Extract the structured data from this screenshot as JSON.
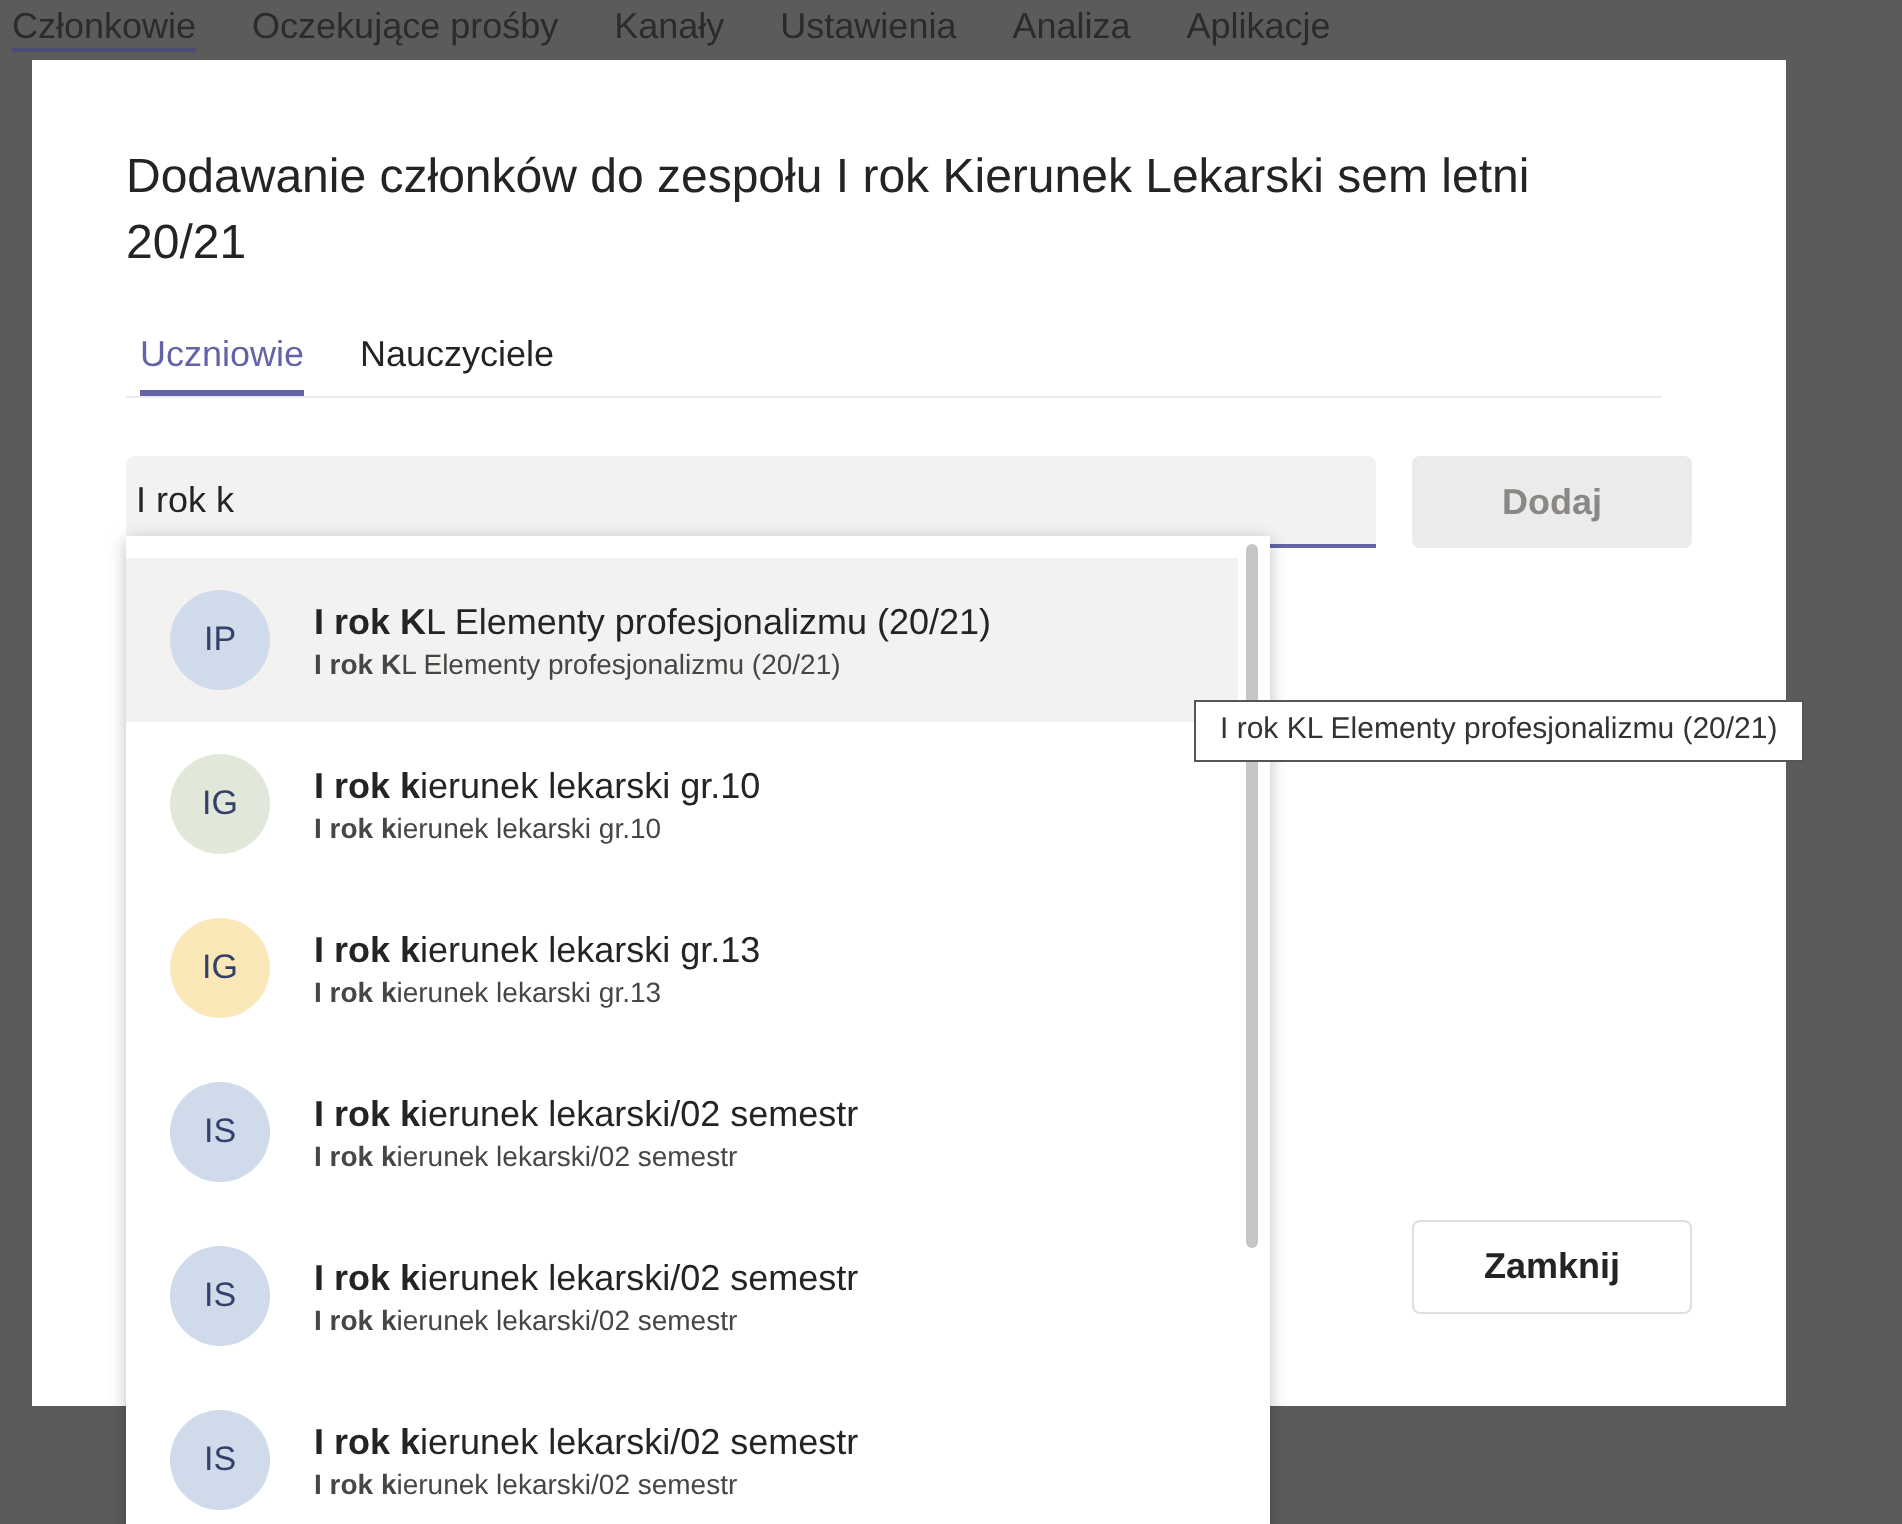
{
  "background_tabs": [
    {
      "label": "Członkowie",
      "selected": true
    },
    {
      "label": "Oczekujące prośby",
      "selected": false
    },
    {
      "label": "Kanały",
      "selected": false
    },
    {
      "label": "Ustawienia",
      "selected": false
    },
    {
      "label": "Analiza",
      "selected": false
    },
    {
      "label": "Aplikacje",
      "selected": false
    }
  ],
  "dialog": {
    "title": "Dodawanie członków do zespołu I rok Kierunek Lekarski sem letni 20/21",
    "tabs": [
      {
        "label": "Uczniowie",
        "selected": true
      },
      {
        "label": "Nauczyciele",
        "selected": false
      }
    ],
    "search": {
      "value": "I rok k"
    },
    "add_button": {
      "label": "Dodaj",
      "disabled": true
    },
    "close_button": {
      "label": "Zamknij"
    }
  },
  "suggestions": [
    {
      "initials": "IP",
      "color": "#cfdaea",
      "title": "**I rok K**L Elementy profesjonalizmu (20/21)",
      "subtitle": "**I rok K**L Elementy profesjonalizmu (20/21)",
      "selected": true
    },
    {
      "initials": "IG",
      "color": "#e1e8da",
      "title": "**I rok k**ierunek lekarski gr.10",
      "subtitle": "**I rok k**ierunek lekarski gr.10",
      "selected": false
    },
    {
      "initials": "IG",
      "color": "#fbe8b9",
      "title": "**I rok k**ierunek lekarski gr.13",
      "subtitle": "**I rok k**ierunek lekarski gr.13",
      "selected": false
    },
    {
      "initials": "IS",
      "color": "#cfdaea",
      "title": "**I rok k**ierunek lekarski/02 semestr",
      "subtitle": "**I rok k**ierunek lekarski/02 semestr",
      "selected": false
    },
    {
      "initials": "IS",
      "color": "#cfdaea",
      "title": "**I rok k**ierunek lekarski/02 semestr",
      "subtitle": "**I rok k**ierunek lekarski/02 semestr",
      "selected": false
    },
    {
      "initials": "IS",
      "color": "#cfdaea",
      "title": "**I rok k**ierunek lekarski/02 semestr",
      "subtitle": "**I rok k**ierunek lekarski/02 semestr",
      "selected": false
    }
  ],
  "tooltip": "I rok KL Elementy profesjonalizmu (20/21)"
}
